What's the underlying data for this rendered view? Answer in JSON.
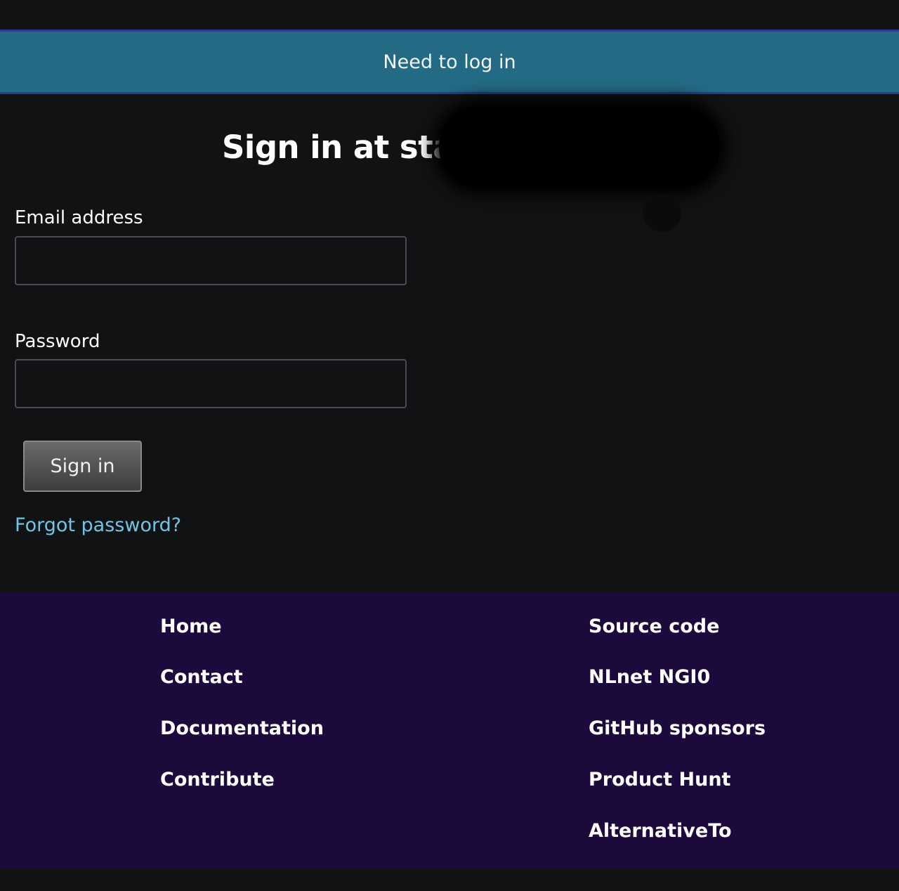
{
  "banner": {
    "text": "Need to log in"
  },
  "page": {
    "title": "Sign in at stats."
  },
  "form": {
    "email_label": "Email address",
    "email_value": "",
    "password_label": "Password",
    "password_value": "",
    "submit_label": "Sign in",
    "forgot_label": "Forgot password?"
  },
  "footer": {
    "left_links": [
      "Home",
      "Contact",
      "Documentation",
      "Contribute"
    ],
    "right_links": [
      "Source code",
      "NLnet NGI0",
      "GitHub sponsors",
      "Product Hunt",
      "AlternativeTo"
    ]
  }
}
